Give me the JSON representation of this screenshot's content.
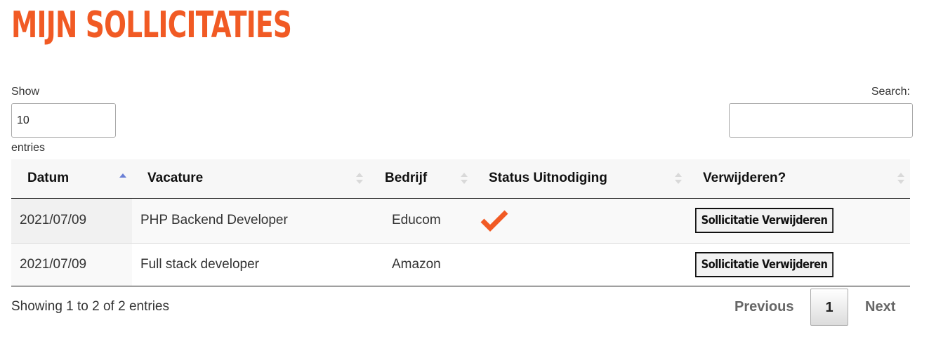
{
  "page": {
    "title": "Mijn sollicitaties"
  },
  "length": {
    "show_label": "Show",
    "value": "10",
    "entries_label": "entries"
  },
  "search": {
    "label": "Search:",
    "value": ""
  },
  "table": {
    "columns": [
      "Datum",
      "Vacature",
      "Bedrijf",
      "Status Uitnodiging",
      "Verwijderen?"
    ],
    "sorted_column": "Datum",
    "sort_direction": "ascending",
    "rows": [
      {
        "datum": "2021/07/09",
        "vacature": "PHP Backend Developer",
        "bedrijf": "Educom",
        "status_icon": "checkmark-icon",
        "button": "Sollicitatie Verwijderen"
      },
      {
        "datum": "2021/07/09",
        "vacature": "Full stack developer",
        "bedrijf": "Amazon",
        "status_icon": "",
        "button": "Sollicitatie Verwijderen"
      }
    ]
  },
  "info": "Showing 1 to 2 of 2 entries",
  "pagination": {
    "previous": "Previous",
    "current": "1",
    "next": "Next"
  },
  "colors": {
    "accent": "#f15a24",
    "sort_active": "#6a7fd6",
    "sort_inactive": "#d9d9d9"
  }
}
